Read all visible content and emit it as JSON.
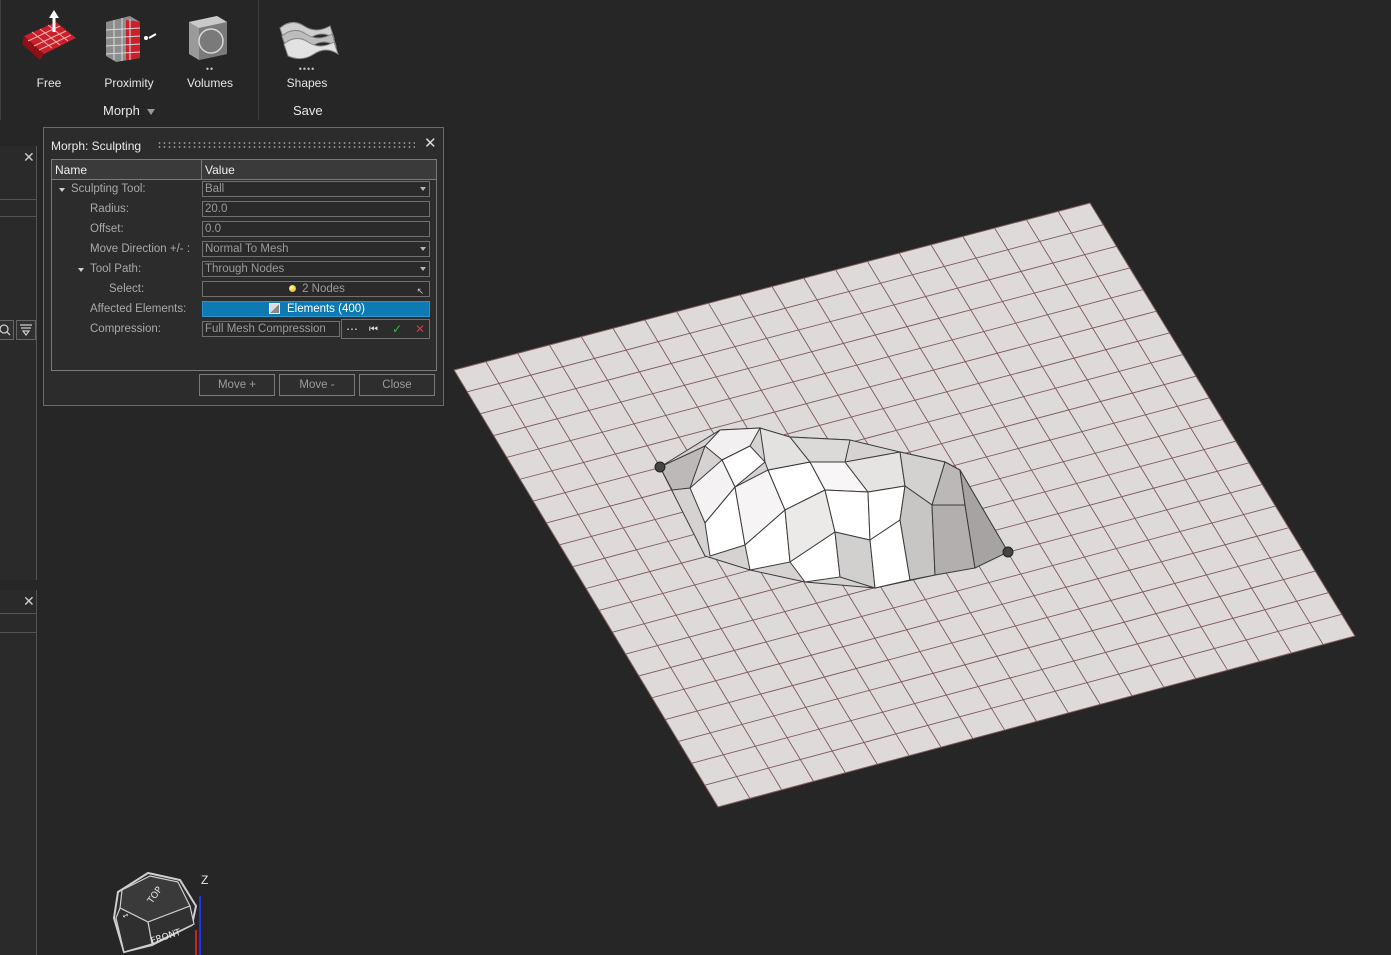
{
  "ribbon": {
    "morph_group": {
      "title": "Morph",
      "buttons": [
        {
          "label": "Free",
          "icon": "free-morph-icon"
        },
        {
          "label": "Proximity",
          "icon": "proximity-morph-icon"
        },
        {
          "label": "Volumes",
          "icon": "volumes-morph-icon"
        }
      ]
    },
    "save_group": {
      "title": "Save",
      "buttons": [
        {
          "label": "Shapes",
          "icon": "shapes-icon"
        }
      ]
    }
  },
  "dialog": {
    "title": "Morph: Sculpting",
    "columns": {
      "name": "Name",
      "value": "Value"
    },
    "rows": {
      "sculpting_tool": {
        "label": "Sculpting Tool:",
        "value": "Ball"
      },
      "radius": {
        "label": "Radius:",
        "value": "20.0"
      },
      "offset": {
        "label": "Offset:",
        "value": "0.0"
      },
      "move_direction": {
        "label": "Move Direction +/- :",
        "value": "Normal To Mesh"
      },
      "tool_path": {
        "label": "Tool Path:",
        "value": "Through Nodes"
      },
      "select": {
        "label": "Select:",
        "value": "2 Nodes"
      },
      "affected_elements": {
        "label": "Affected Elements:",
        "value": "Elements (400)"
      },
      "compression": {
        "label": "Compression:",
        "value": "Full Mesh Compression"
      }
    },
    "buttons": {
      "move_plus": "Move +",
      "move_minus": "Move -",
      "close": "Close"
    }
  },
  "viewport": {
    "view_cube": {
      "top_label": "TOP",
      "front_label": "FRONT"
    },
    "axis_label": "Z"
  },
  "colors": {
    "background": "#262626",
    "mesh_fill": "#dedad9",
    "mesh_lines": "#7d5a5c",
    "selection_blue": "#0e7ab3",
    "accept_green": "#2fbf3a",
    "reject_red": "#d23a3a"
  }
}
